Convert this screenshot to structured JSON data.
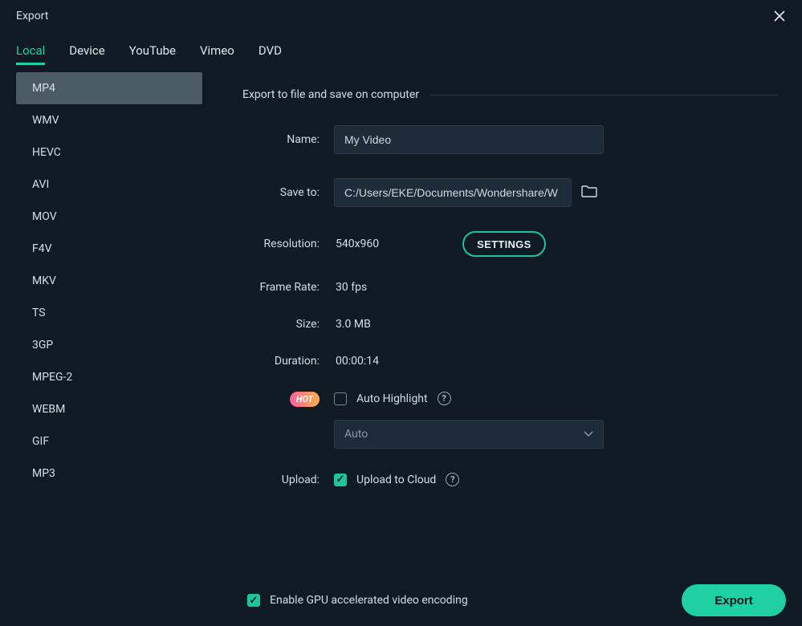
{
  "window": {
    "title": "Export"
  },
  "tabs": {
    "items": [
      "Local",
      "Device",
      "YouTube",
      "Vimeo",
      "DVD"
    ],
    "active": 0
  },
  "formats": {
    "items": [
      "MP4",
      "WMV",
      "HEVC",
      "AVI",
      "MOV",
      "F4V",
      "MKV",
      "TS",
      "3GP",
      "MPEG-2",
      "WEBM",
      "GIF",
      "MP3"
    ],
    "active": 0
  },
  "section": {
    "title": "Export to file and save on computer"
  },
  "fields": {
    "name_label": "Name:",
    "name_value": "My Video",
    "saveto_label": "Save to:",
    "saveto_value": "C:/Users/EKE/Documents/Wondershare/W",
    "resolution_label": "Resolution:",
    "resolution_value": "540x960",
    "settings_button": "SETTINGS",
    "framerate_label": "Frame Rate:",
    "framerate_value": "30 fps",
    "size_label": "Size:",
    "size_value": "3.0 MB",
    "duration_label": "Duration:",
    "duration_value": "00:00:14",
    "hot_badge": "HOT",
    "autohighlight_label": "Auto Highlight",
    "autohighlight_checked": false,
    "autohighlight_dropdown": "Auto",
    "upload_label": "Upload:",
    "uploadcloud_label": "Upload to Cloud",
    "uploadcloud_checked": true
  },
  "footer": {
    "gpu_label": "Enable GPU accelerated video encoding",
    "gpu_checked": true,
    "export_button": "Export"
  }
}
